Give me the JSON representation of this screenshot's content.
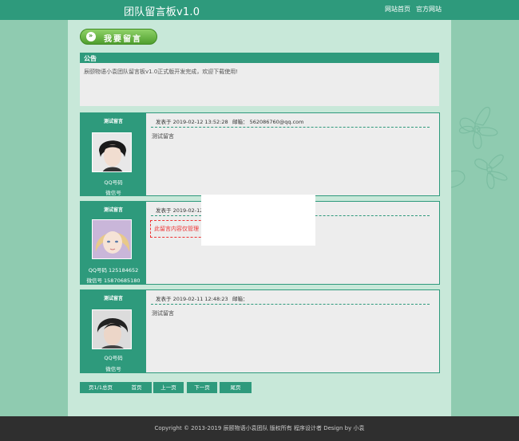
{
  "header": {
    "title": "团队留言板v1.0",
    "nav": [
      "网站首页",
      "官方网站"
    ]
  },
  "post_button": {
    "label": "我要留言"
  },
  "notice": {
    "title": "公告",
    "body": "辰颐物语小袁团队留言板v1.0正式版开发完成，欢迎下载使用!"
  },
  "messages": [
    {
      "author": "测试留言",
      "qq_line": "QQ号码",
      "wechat_line": "微信号",
      "posted": "发表于 2019-02-12 13:52:28",
      "email": "邮箱： 562086760@qq.com",
      "content": "测试留言"
    },
    {
      "author": "测试留言",
      "qq_line": "QQ号码 125184652",
      "wechat_line": "微信号 15870685180",
      "posted": "发表于 2019-02-12 1",
      "email": "",
      "content": "此留言内容仅管理"
    },
    {
      "author": "测试留言",
      "qq_line": "QQ号码",
      "wechat_line": "微信号",
      "posted": "发表于 2019-02-11 12:48:23",
      "email": "邮箱：",
      "content": "测试留言"
    }
  ],
  "pager": [
    "页1/1总页",
    "首页",
    "上一页",
    "下一页",
    "尾页"
  ],
  "footer": {
    "text": "Copyright © 2013-2019 辰颐物语小袁团队 版权所有    程序设计者 Design by 小袁"
  },
  "colors": {
    "primary": "#2e9a7c",
    "panel": "#ededed",
    "main_bg": "#c8e8d9",
    "side_bg": "#8fcbb0",
    "footer_bg": "#2f2f2f",
    "button_green": "#5aab36"
  }
}
